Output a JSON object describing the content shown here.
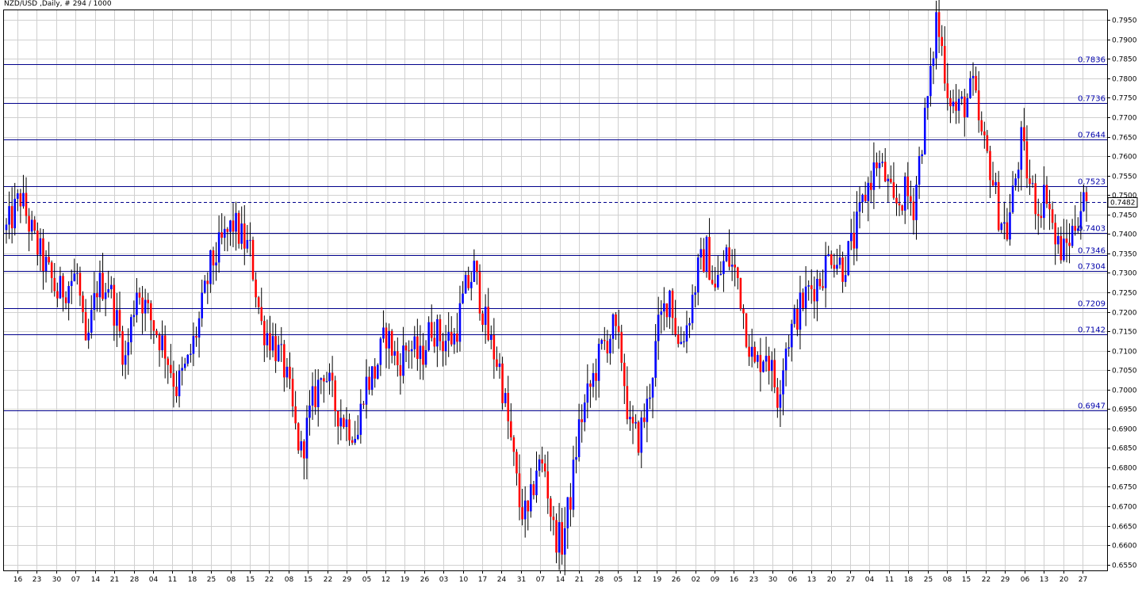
{
  "header": {
    "title": "NZD/USD ,Daily, # 294 / 1000"
  },
  "colors": {
    "bull": "#0000ff",
    "bear": "#ff0000",
    "wick": "#000000",
    "grid": "#d0d0d0",
    "level": "#00008b",
    "level_label": "#0000aa",
    "current_price_line": "#00008b"
  },
  "chart_data": {
    "type": "candlestick",
    "symbol": "NZD/USD",
    "timeframe": "Daily",
    "bar_count_label": "# 294 / 1000",
    "ylim": [
      0.6535,
      0.7975
    ],
    "grid": true,
    "y_ticks": [
      "0.6550",
      "0.6600",
      "0.6650",
      "0.6700",
      "0.6750",
      "0.6800",
      "0.6850",
      "0.6900",
      "0.6950",
      "0.7000",
      "0.7050",
      "0.7100",
      "0.7150",
      "0.7200",
      "0.7250",
      "0.7300",
      "0.7350",
      "0.7400",
      "0.7450",
      "0.7500",
      "0.7550",
      "0.7600",
      "0.7650",
      "0.7700",
      "0.7750",
      "0.7800",
      "0.7850",
      "0.7900",
      "0.7950"
    ],
    "x_ticks": [
      "16",
      "23",
      "30",
      "07",
      "14",
      "21",
      "28",
      "04",
      "11",
      "18",
      "25",
      "08",
      "15",
      "22",
      "08",
      "15",
      "22",
      "29",
      "05",
      "12",
      "19",
      "26",
      "03",
      "10",
      "17",
      "24",
      "31",
      "07",
      "14",
      "21",
      "28",
      "05",
      "12",
      "19",
      "26",
      "02",
      "09",
      "16",
      "23",
      "30",
      "06",
      "13",
      "20",
      "27",
      "04",
      "11",
      "18",
      "25",
      "08",
      "15",
      "22",
      "29",
      "06",
      "13",
      "20",
      "27"
    ],
    "levels": [
      {
        "value": 0.7836,
        "label": "0.7836"
      },
      {
        "value": 0.7736,
        "label": "0.7736"
      },
      {
        "value": 0.7644,
        "label": "0.7644"
      },
      {
        "value": 0.7523,
        "label": "0.7523"
      },
      {
        "value": 0.7403,
        "label": "0.7403"
      },
      {
        "value": 0.7346,
        "label": "0.7346"
      },
      {
        "value": 0.7304,
        "label": "0.7304"
      },
      {
        "value": 0.7209,
        "label": "0.7209"
      },
      {
        "value": 0.7142,
        "label": "0.7142"
      },
      {
        "value": 0.6947,
        "label": "0.6947"
      }
    ],
    "current_price": {
      "value": 0.7482,
      "label": "0.7482"
    },
    "close_path": [
      [
        0,
        0.741
      ],
      [
        5,
        0.7495
      ],
      [
        10,
        0.738
      ],
      [
        18,
        0.7245
      ],
      [
        25,
        0.7295
      ],
      [
        28,
        0.709
      ],
      [
        32,
        0.7265
      ],
      [
        36,
        0.7275
      ],
      [
        42,
        0.7075
      ],
      [
        46,
        0.7265
      ],
      [
        50,
        0.7195
      ],
      [
        56,
        0.7105
      ],
      [
        60,
        0.7005
      ],
      [
        64,
        0.7065
      ],
      [
        68,
        0.7175
      ],
      [
        72,
        0.7315
      ],
      [
        76,
        0.7375
      ],
      [
        80,
        0.7425
      ],
      [
        86,
        0.7355
      ],
      [
        90,
        0.7165
      ],
      [
        94,
        0.7125
      ],
      [
        98,
        0.7055
      ],
      [
        100,
        0.6985
      ],
      [
        102,
        0.6895
      ],
      [
        104,
        0.6835
      ],
      [
        108,
        0.6965
      ],
      [
        112,
        0.7055
      ],
      [
        116,
        0.6955
      ],
      [
        120,
        0.6915
      ],
      [
        124,
        0.6885
      ],
      [
        126,
        0.7005
      ],
      [
        130,
        0.7045
      ],
      [
        134,
        0.7145
      ],
      [
        138,
        0.7065
      ],
      [
        142,
        0.7115
      ],
      [
        146,
        0.7075
      ],
      [
        150,
        0.7165
      ],
      [
        154,
        0.7125
      ],
      [
        158,
        0.7135
      ],
      [
        162,
        0.7255
      ],
      [
        165,
        0.7305
      ],
      [
        168,
        0.7205
      ],
      [
        170,
        0.7135
      ],
      [
        174,
        0.7055
      ],
      [
        178,
        0.6865
      ],
      [
        181,
        0.6705
      ],
      [
        184,
        0.6665
      ],
      [
        187,
        0.6805
      ],
      [
        190,
        0.6795
      ],
      [
        193,
        0.6635
      ],
      [
        196,
        0.6605
      ],
      [
        199,
        0.6725
      ],
      [
        202,
        0.6905
      ],
      [
        206,
        0.7005
      ],
      [
        210,
        0.7105
      ],
      [
        214,
        0.7155
      ],
      [
        217,
        0.7085
      ],
      [
        220,
        0.6895
      ],
      [
        223,
        0.6875
      ],
      [
        226,
        0.6955
      ],
      [
        230,
        0.7155
      ],
      [
        234,
        0.7255
      ],
      [
        237,
        0.7115
      ],
      [
        240,
        0.7165
      ],
      [
        244,
        0.7305
      ],
      [
        247,
        0.7355
      ],
      [
        250,
        0.7255
      ],
      [
        254,
        0.7345
      ],
      [
        258,
        0.7285
      ],
      [
        261,
        0.7155
      ],
      [
        264,
        0.7055
      ],
      [
        268,
        0.7105
      ],
      [
        272,
        0.6985
      ],
      [
        275,
        0.7115
      ],
      [
        279,
        0.7195
      ],
      [
        283,
        0.7255
      ],
      [
        287,
        0.7285
      ],
      [
        291,
        0.7355
      ],
      [
        295,
        0.7315
      ],
      [
        299,
        0.7385
      ],
      [
        303,
        0.7505
      ],
      [
        307,
        0.7585
      ],
      [
        310,
        0.7545
      ],
      [
        313,
        0.7465
      ],
      [
        317,
        0.7505
      ],
      [
        320,
        0.7475
      ],
      [
        323,
        0.7645
      ],
      [
        326,
        0.7795
      ],
      [
        328,
        0.7955
      ],
      [
        330,
        0.7875
      ],
      [
        332,
        0.7775
      ],
      [
        335,
        0.7715
      ],
      [
        338,
        0.7735
      ],
      [
        341,
        0.7775
      ],
      [
        344,
        0.7645
      ],
      [
        347,
        0.7575
      ],
      [
        350,
        0.7455
      ],
      [
        353,
        0.7405
      ],
      [
        356,
        0.7545
      ],
      [
        358,
        0.7635
      ],
      [
        361,
        0.7525
      ],
      [
        364,
        0.7465
      ],
      [
        367,
        0.7515
      ],
      [
        370,
        0.7375
      ],
      [
        373,
        0.7355
      ],
      [
        376,
        0.7405
      ],
      [
        379,
        0.7475
      ],
      [
        381,
        0.7482
      ]
    ]
  }
}
